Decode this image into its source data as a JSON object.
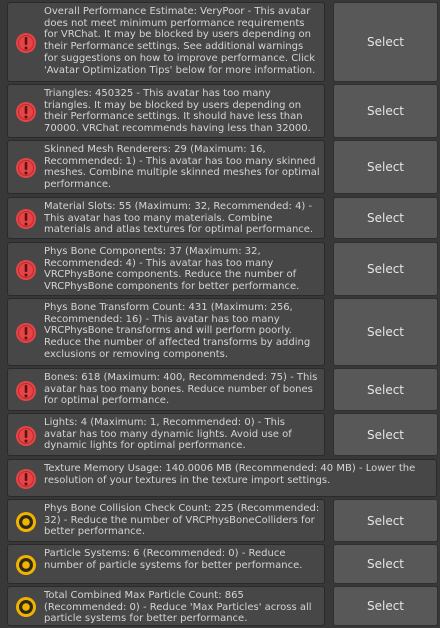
{
  "select_label": "Select",
  "colors": {
    "error": "#e64446",
    "warning": "#f2b300"
  },
  "messages": [
    {
      "severity": "error",
      "text": "Overall Performance Estimate: VeryPoor - This avatar does not meet minimum performance requirements for VRChat. It may be blocked by users depending on their Performance settings. See additional warnings for suggestions on how to improve performance. Click 'Avatar Optimization Tips' below for more information."
    },
    {
      "severity": "error",
      "text": "Triangles: 450325 - This avatar has too many triangles. It may be blocked by users depending on their Performance settings. It should have less than 70000. VRChat recommends having less than 32000."
    },
    {
      "severity": "error",
      "text": "Skinned Mesh Renderers: 29 (Maximum: 16, Recommended: 1) - This avatar has too many skinned meshes. Combine multiple skinned meshes for optimal performance."
    },
    {
      "severity": "error",
      "text": "Material Slots: 55 (Maximum: 32, Recommended: 4) - This avatar has too many materials. Combine materials and atlas textures for optimal performance."
    },
    {
      "severity": "error",
      "text": "Phys Bone Components: 37 (Maximum: 32, Recommended: 4) - This avatar has too many VRCPhysBone components. Reduce the number of VRCPhysBone components for better performance."
    },
    {
      "severity": "error",
      "text": "Phys Bone Transform Count: 431 (Maximum: 256, Recommended: 16) - This avatar has too many VRCPhysBone transforms and will perform poorly. Reduce the number of affected transforms by adding exclusions or removing components."
    },
    {
      "severity": "error",
      "text": "Bones: 618 (Maximum: 400, Recommended: 75) - This avatar has too many bones. Reduce number of bones for optimal performance."
    },
    {
      "severity": "error",
      "text": "Lights: 4 (Maximum: 1, Recommended: 0) - This avatar has too many dynamic lights. Avoid use of dynamic lights for optimal performance."
    },
    {
      "severity": "error",
      "text": "Texture Memory Usage: 140.0006 MB (Recommended: 40 MB) - Lower the resolution of your textures in the texture import settings."
    },
    {
      "severity": "warning",
      "text": "Phys Bone Collision Check Count: 225 (Recommended: 32) - Reduce the number of VRCPhysBoneColliders for better performance."
    },
    {
      "severity": "warning",
      "text": "Particle Systems: 6 (Recommended: 0) - Reduce number of particle systems for better performance."
    },
    {
      "severity": "warning",
      "text": "Total Combined Max Particle Count: 865 (Recommended: 0) - Reduce 'Max Particles' across all particle systems for better performance."
    }
  ]
}
